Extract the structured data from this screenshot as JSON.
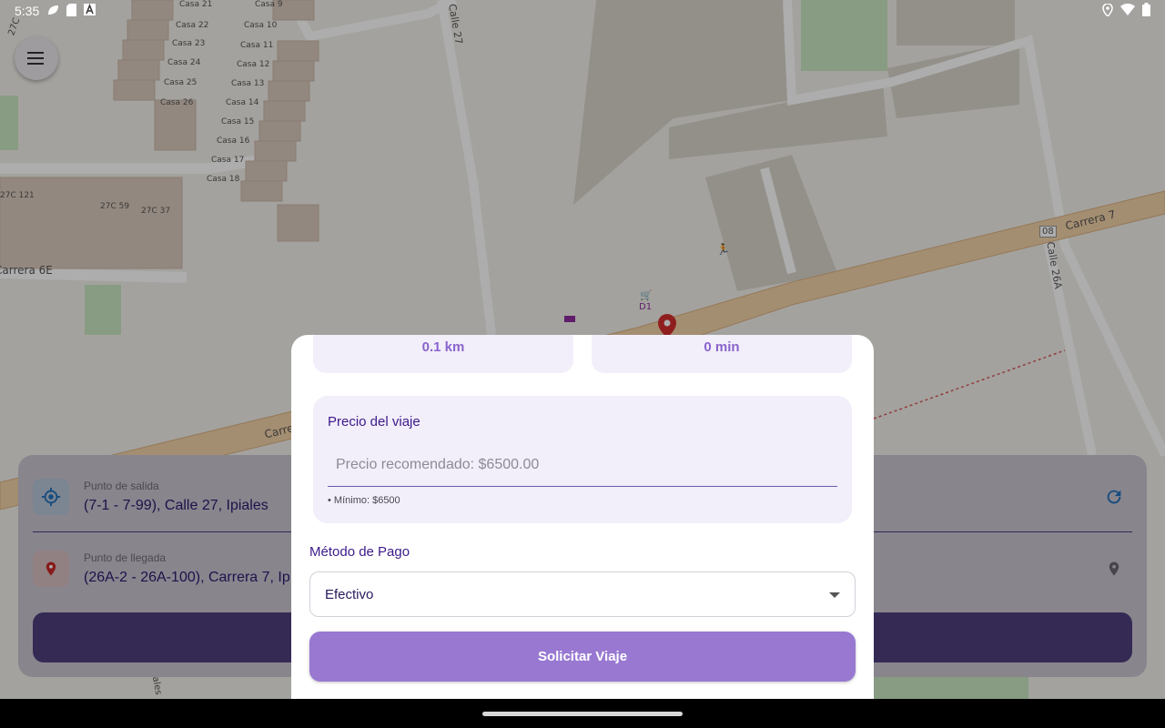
{
  "status_bar": {
    "time": "5:35",
    "left_icons": [
      "leaf-icon",
      "sd-card-icon",
      "a-notification-icon"
    ],
    "right_icons": [
      "location-icon",
      "wifi-icon",
      "battery-icon"
    ]
  },
  "map": {
    "street_labels": [
      "Calle 27",
      "Calle 26A",
      "Carrera 7",
      "Carrera 6E",
      "Carrera 7",
      "27C",
      "27C 121",
      "27C 59",
      "27C 37",
      "08",
      "D1",
      "ales"
    ],
    "house_labels": [
      "Casa 21",
      "Casa 22",
      "Casa 23",
      "Casa 24",
      "Casa 25",
      "Casa 26",
      "Casa 9",
      "Casa 10",
      "Casa 11",
      "Casa 12",
      "Casa 13",
      "Casa 14",
      "Casa 15",
      "Casa 16",
      "Casa 17",
      "Casa 18"
    ]
  },
  "route_card": {
    "origin_label": "Punto de salida",
    "origin_value": "(7-1 - 7-99), Calle 27, Ipiales",
    "destination_label": "Punto de llegada",
    "destination_value": "(26A-2 - 26A-100), Carrera 7, Ip"
  },
  "sheet": {
    "distance": "0.1 km",
    "duration": "0 min",
    "price_title": "Precio del viaje",
    "price_placeholder": "Precio recomendado: $6500.00",
    "price_hint": "• Mínimo: $6500",
    "payment_label": "Método de Pago",
    "payment_selected": "Efectivo",
    "submit_label": "Solicitar Viaje"
  },
  "colors": {
    "accent": "#9878d1",
    "primary_text": "#3d1a8a",
    "card_bg": "#f2eefa"
  }
}
